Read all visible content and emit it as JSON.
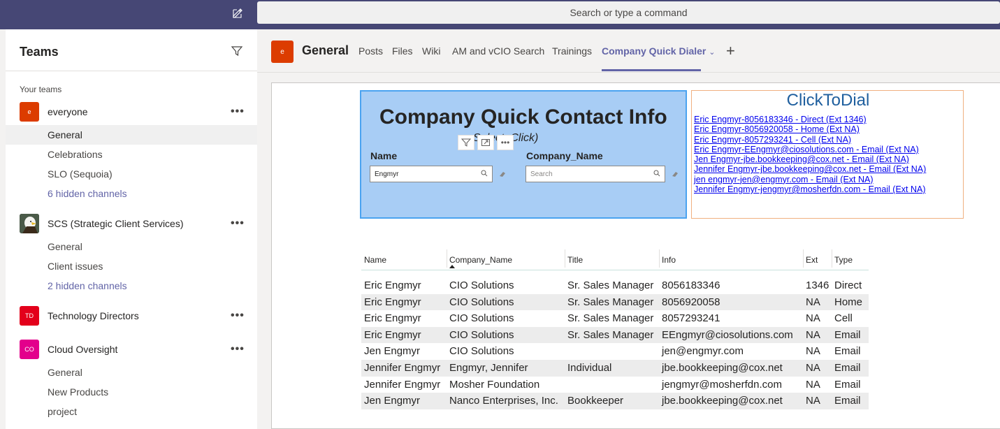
{
  "search": {
    "placeholder": "Search or type a command"
  },
  "teams": {
    "title": "Teams",
    "your_teams_label": "Your teams",
    "list": [
      {
        "name": "everyone",
        "avatar_text": "e",
        "avatar_color": "#dc3c00",
        "channels": [
          "General",
          "Celebrations",
          "SLO (Sequoia)",
          "6 hidden channels"
        ]
      },
      {
        "name": "SCS (Strategic Client Services)",
        "avatar_text": "",
        "avatar_color": "#3b4a3a",
        "channels": [
          "General",
          "Client issues",
          "2 hidden channels"
        ]
      },
      {
        "name": "Technology Directors",
        "avatar_text": "TD",
        "avatar_color": "#e3001b",
        "channels": []
      },
      {
        "name": "Cloud Oversight",
        "avatar_text": "CO",
        "avatar_color": "#e3008c",
        "channels": [
          "General",
          "New Products",
          "project"
        ]
      }
    ]
  },
  "channel_header": {
    "avatar_text": "e",
    "title": "General",
    "tabs": [
      "Posts",
      "Files",
      "Wiki",
      "AM and vCIO Search",
      "Trainings",
      "Company Quick Dialer"
    ],
    "active_tab": "Company Quick Dialer"
  },
  "report": {
    "title": "Company Quick Contact Info",
    "subtitle": "Select, Click)",
    "slicers": [
      {
        "label": "Name",
        "value": "Engmyr",
        "placeholder": ""
      },
      {
        "label": "Company_Name",
        "value": "",
        "placeholder": "Search"
      }
    ],
    "click_to_dial": {
      "title": "ClickToDial",
      "links": [
        "Eric Engmyr-8056183346 - Direct (Ext 1346)",
        "Eric Engmyr-8056920058 - Home (Ext NA)",
        "Eric Engmyr-8057293241 - Cell (Ext NA)",
        "Eric Engmyr-EEngmyr@ciosolutions.com - Email (Ext NA)",
        "Jen Engmyr-jbe.bookkeeping@cox.net - Email (Ext NA)",
        "Jennifer Engmyr-jbe.bookkeeping@cox.net - Email (Ext NA)",
        "jen engmyr-jen@engmyr.com - Email (Ext NA)",
        "Jennifer Engmyr-jengmyr@mosherfdn.com - Email (Ext NA)"
      ]
    },
    "table": {
      "columns": [
        "Name",
        "Company_Name",
        "Title",
        "Info",
        "Ext",
        "Type"
      ],
      "rows": [
        [
          "Eric Engmyr",
          "CIO Solutions",
          "Sr. Sales Manager",
          "8056183346",
          "1346",
          "Direct"
        ],
        [
          "Eric Engmyr",
          "CIO Solutions",
          "Sr. Sales Manager",
          "8056920058",
          "NA",
          "Home"
        ],
        [
          "Eric Engmyr",
          "CIO Solutions",
          "Sr. Sales Manager",
          "8057293241",
          "NA",
          "Cell"
        ],
        [
          "Eric Engmyr",
          "CIO Solutions",
          "Sr. Sales Manager",
          "EEngmyr@ciosolutions.com",
          "NA",
          "Email"
        ],
        [
          "Jen Engmyr",
          "CIO Solutions",
          "",
          "jen@engmyr.com",
          "NA",
          "Email"
        ],
        [
          "Jennifer Engmyr",
          "Engmyr, Jennifer",
          "Individual",
          "jbe.bookkeeping@cox.net",
          "NA",
          "Email"
        ],
        [
          "Jennifer Engmyr",
          "Mosher Foundation",
          "",
          "jengmyr@mosherfdn.com",
          "NA",
          "Email"
        ],
        [
          "Jen Engmyr",
          "Nanco Enterprises, Inc.",
          "Bookkeeper",
          "jbe.bookkeeping@cox.net",
          "NA",
          "Email"
        ]
      ]
    }
  }
}
